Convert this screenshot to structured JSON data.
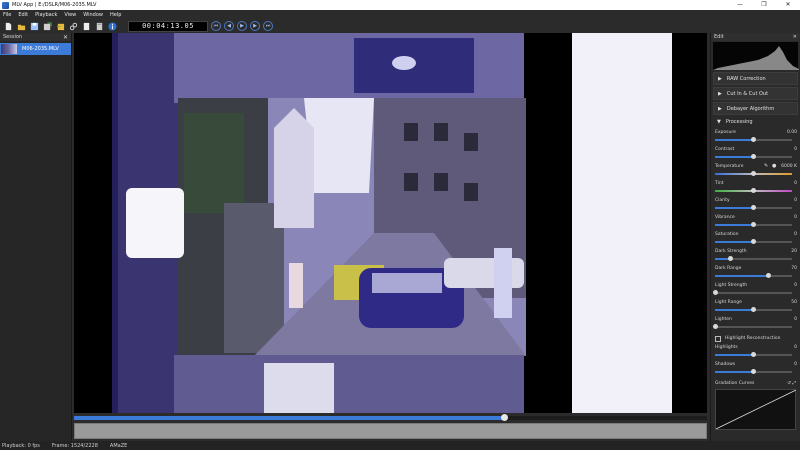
{
  "window": {
    "title": "MLV App | E:/DSLR/M06-2035.MLV",
    "controls": [
      "—",
      "❐",
      "✕"
    ]
  },
  "menu": [
    "File",
    "Edit",
    "Playback",
    "View",
    "Window",
    "Help"
  ],
  "toolbar": {
    "icons": [
      "new-session-icon",
      "open-folder-icon",
      "save-icon",
      "export-icon",
      "import-icon",
      "link-icon",
      "copy-icon",
      "paste-icon",
      "info-icon"
    ],
    "timecode": "00:04:13.05",
    "playback_buttons": [
      "skip-start-icon",
      "step-back-icon",
      "play-icon",
      "step-forward-icon",
      "skip-end-icon"
    ]
  },
  "session": {
    "title": "Session",
    "close": "✕",
    "clips": [
      {
        "name": "M06-2035.MLV",
        "selected": true
      }
    ]
  },
  "timeline": {
    "position_fraction": 0.68
  },
  "status": {
    "playback": "Playback: 0 fps",
    "frame": "Frame: 1524/2228",
    "codec": "AMaZE"
  },
  "edit": {
    "title": "Edit",
    "close": "✕",
    "sections": [
      {
        "label": "RAW Correction",
        "expanded": false
      },
      {
        "label": "Cut In & Cut Out",
        "expanded": false
      },
      {
        "label": "Debayer Algorithm",
        "expanded": false
      }
    ],
    "processing": {
      "label": "Processing",
      "sliders": [
        {
          "label": "Exposure",
          "value": "0.00",
          "fraction": 0.5
        },
        {
          "label": "Contrast",
          "value": "0",
          "fraction": 0.5
        },
        {
          "label": "Temperature",
          "value": "6000 K",
          "fraction": 0.5,
          "kind": "temp"
        },
        {
          "label": "Tint",
          "value": "0",
          "fraction": 0.5,
          "kind": "tint"
        },
        {
          "label": "Clarity",
          "value": "0",
          "fraction": 0.5
        },
        {
          "label": "Vibrance",
          "value": "0",
          "fraction": 0.5
        },
        {
          "label": "Saturation",
          "value": "0",
          "fraction": 0.5
        },
        {
          "label": "Dark Strength",
          "value": "20",
          "fraction": 0.2
        },
        {
          "label": "Dark Range",
          "value": "70",
          "fraction": 0.7
        },
        {
          "label": "Light Strength",
          "value": "0",
          "fraction": 0.0
        },
        {
          "label": "Light Range",
          "value": "50",
          "fraction": 0.5
        },
        {
          "label": "Lighten",
          "value": "0",
          "fraction": 0.0
        }
      ],
      "highlight_reconstruction": "Highlight Reconstruction",
      "sliders2": [
        {
          "label": "Highlights",
          "value": "0",
          "fraction": 0.5
        },
        {
          "label": "Shadows",
          "value": "0",
          "fraction": 0.5
        }
      ],
      "gradation_curves": "Gradation Curves"
    }
  },
  "colors": {
    "accent": "#3d7bd8",
    "panel": "#2a2a2a",
    "background": "#2b2b2b"
  }
}
